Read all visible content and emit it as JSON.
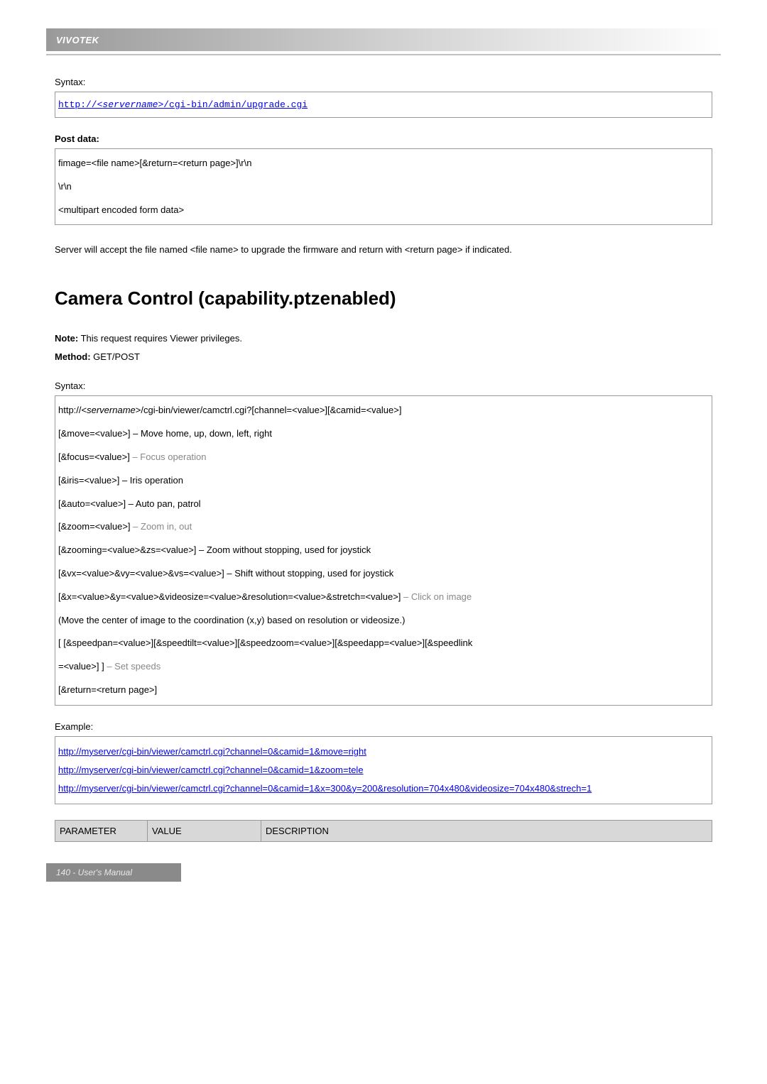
{
  "header": {
    "brand": "VIVOTEK"
  },
  "section1": {
    "syntax_label": "Syntax:",
    "syntax_code_prefix": "http://<",
    "syntax_code_var": "servername",
    "syntax_code_suffix": ">/cgi-bin/admin/upgrade.cgi",
    "postdata_heading": "Post data:",
    "post_lines": [
      "fimage=<file name>[&return=<return page>]\\r\\n",
      "\\r\\n",
      "<multipart encoded form data>"
    ],
    "paragraph": "Server will accept the file named <file name> to upgrade the firmware and return with <return page> if indicated."
  },
  "section2": {
    "title": "Camera Control (capability.ptzenabled)",
    "note_label": "Note:",
    "note_text": " This request requires Viewer privileges.",
    "method_label": "Method:",
    "method_text": " GET/POST",
    "syntax_label": "Syntax:",
    "lines": [
      {
        "t": "http://<",
        "var": "servername",
        "t2": ">/cgi-bin/viewer/camctrl.cgi?[channel=<value>][&camid=<value>]"
      },
      {
        "plain": "[&move=<value>] – Move home, up, down, left, right"
      },
      {
        "pre": "[&focus=<value>]",
        "gray": " – Focus operation"
      },
      {
        "plain": "[&iris=<value>] – Iris operation"
      },
      {
        "plain": "[&auto=<value>] – Auto pan, patrol"
      },
      {
        "pre": "[&zoom=<value>]",
        "gray": " – Zoom in, out"
      },
      {
        "plain": "[&zooming=<value>&zs=<value>] – Zoom without stopping, used for joystick"
      },
      {
        "plain": "[&vx=<value>&vy=<value>&vs=<value>] – Shift without stopping, used for joystick"
      },
      {
        "pre": "[&x=<value>&y=<value>&videosize=<value>&resolution=<value>&stretch=<value>]",
        "gray": " – Click on image"
      },
      {
        "plain": "(Move the center of image to the coordination (x,y) based on resolution or videosize.)"
      },
      {
        "plain": "[ [&speedpan=<value>][&speedtilt=<value>][&speedzoom=<value>][&speedapp=<value>][&speedlink"
      },
      {
        "pre": "=<value>] ]",
        "gray": " – Set speeds"
      },
      {
        "plain": "[&return=<return page>]"
      }
    ],
    "example_label": "Example:",
    "example_links": [
      "http://myserver/cgi-bin/viewer/camctrl.cgi?channel=0&camid=1&move=right",
      "http://myserver/cgi-bin/viewer/camctrl.cgi?channel=0&camid=1&zoom=tele",
      "http://myserver/cgi-bin/viewer/camctrl.cgi?channel=0&camid=1&x=300&y=200&resolution=704x480&videosize=704x480&strech=1"
    ],
    "table": {
      "headers": [
        "PARAMETER",
        "VALUE",
        "DESCRIPTION"
      ]
    }
  },
  "footer": {
    "text": "140 - User's Manual"
  }
}
